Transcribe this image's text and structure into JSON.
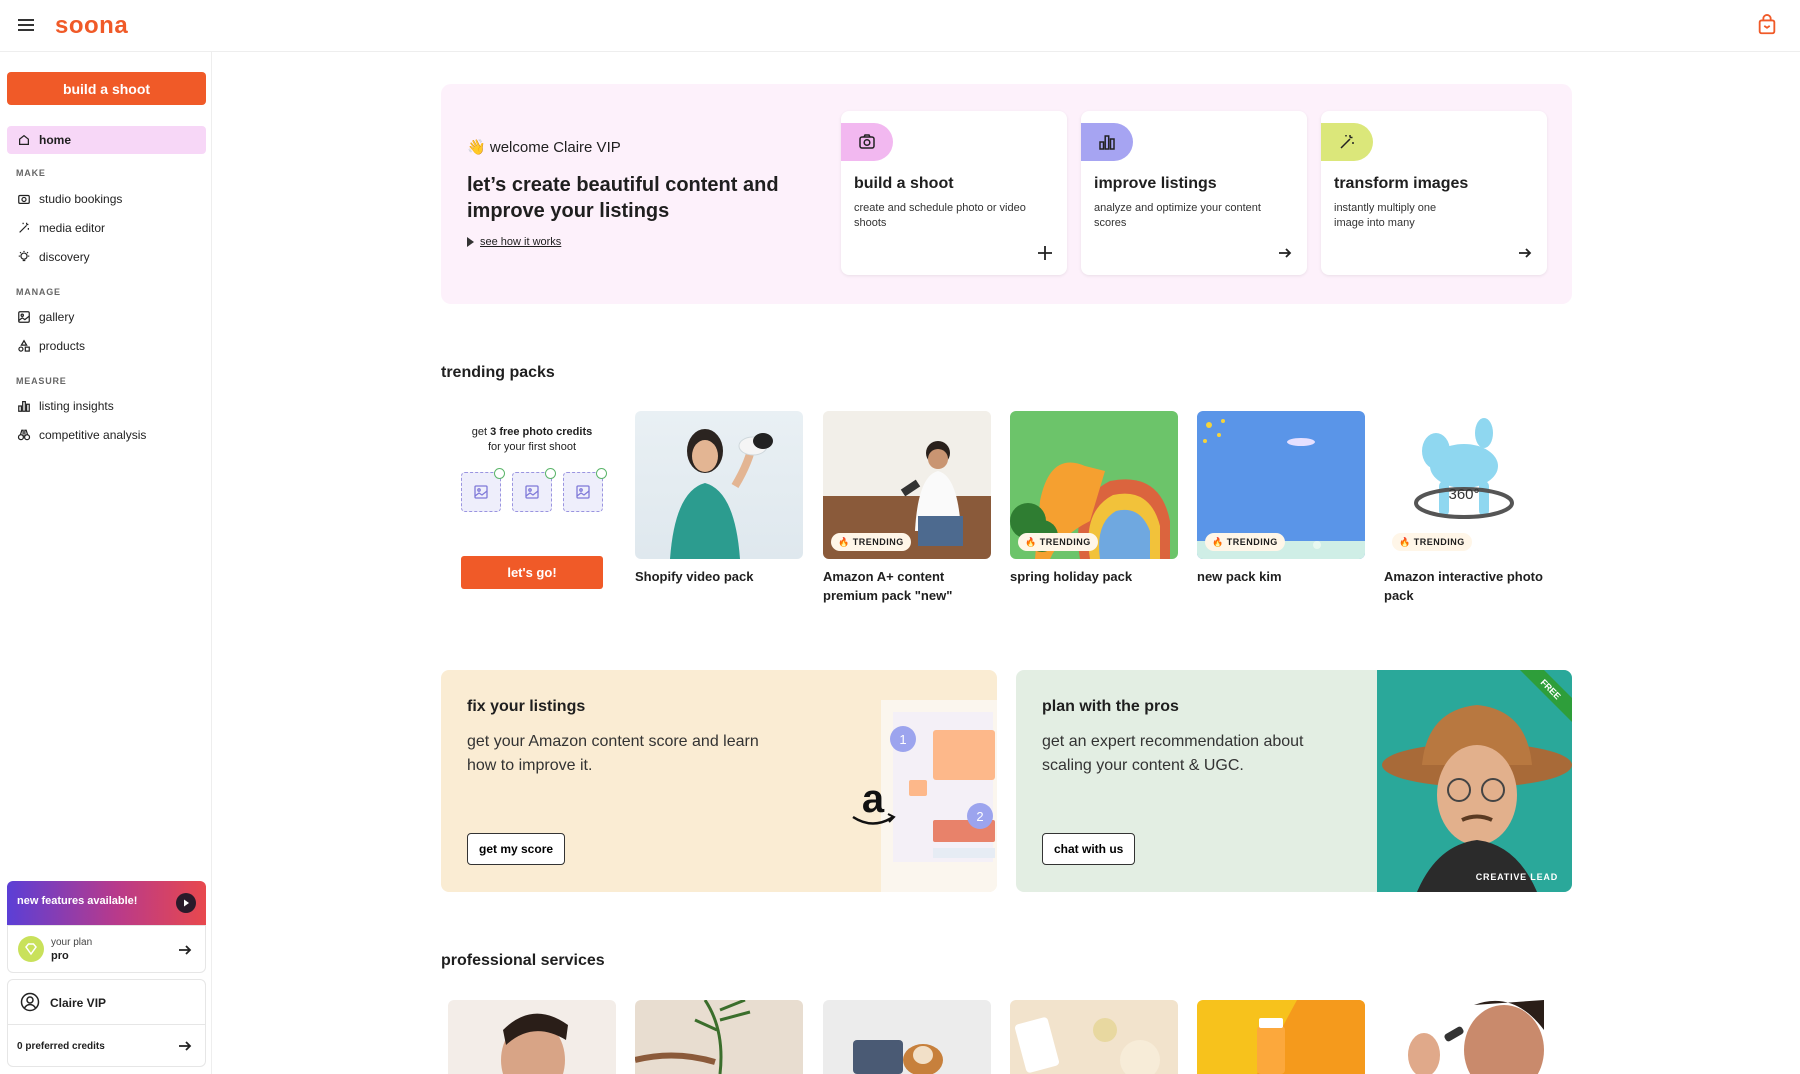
{
  "app": {
    "logo": "soona"
  },
  "sidebar": {
    "build_button": "build a shoot",
    "home": "home",
    "sections": {
      "make": "MAKE",
      "manage": "MANAGE",
      "measure": "MEASURE"
    },
    "make_items": [
      "studio bookings",
      "media editor",
      "discovery"
    ],
    "manage_items": [
      "gallery",
      "products"
    ],
    "measure_items": [
      "listing insights",
      "competitive analysis"
    ],
    "features_banner": "new features available!",
    "plan": {
      "label": "your plan",
      "name": "pro"
    },
    "user": {
      "name": "Claire VIP",
      "credits": "0 preferred credits"
    }
  },
  "hero": {
    "greeting_emoji": "👋",
    "greeting": "welcome Claire VIP",
    "title": "let’s create beautiful content and improve your listings",
    "link": "see how it works",
    "cards": [
      {
        "title": "build a shoot",
        "desc": "create and schedule photo or video shoots",
        "icon": "camera-icon",
        "color": "#f2b8f0"
      },
      {
        "title": "improve listings",
        "desc": "analyze and optimize your content scores",
        "icon": "bar-chart-icon",
        "color": "#a6a4f2"
      },
      {
        "title": "transform images",
        "desc": "instantly multiply one image into many",
        "icon": "magic-wand-icon",
        "color": "#dbe77a"
      }
    ]
  },
  "trending": {
    "title": "trending packs",
    "promo": {
      "text_prefix": "get ",
      "text_bold": "3 free photo credits",
      "text_suffix": "for your first shoot",
      "button": "let's go!"
    },
    "badge_label": "TRENDING",
    "packs": [
      {
        "name": "Shopify video pack",
        "trending": false
      },
      {
        "name": "Amazon A+ content premium pack \"new\"",
        "trending": true
      },
      {
        "name": "spring holiday pack",
        "trending": true
      },
      {
        "name": "new pack kim",
        "trending": true
      },
      {
        "name": "Amazon interactive photo pack",
        "trending": true,
        "overlay": "360°"
      }
    ]
  },
  "banners": {
    "fix": {
      "title": "fix your listings",
      "text": "get your Amazon content score and learn how to improve it.",
      "button": "get my score",
      "step1": "1",
      "step2": "2",
      "brand_glyph": "a"
    },
    "plan": {
      "title": "plan with the pros",
      "text": "get an expert recommendation about scaling your content & UGC.",
      "button": "chat with us",
      "ribbon": "FREE",
      "caption": "CREATIVE LEAD"
    }
  },
  "services": {
    "title": "professional services"
  },
  "colors": {
    "accent": "#f05a28",
    "home_bg": "#f7d7f7",
    "hero_bg": "#fdf1fb"
  }
}
